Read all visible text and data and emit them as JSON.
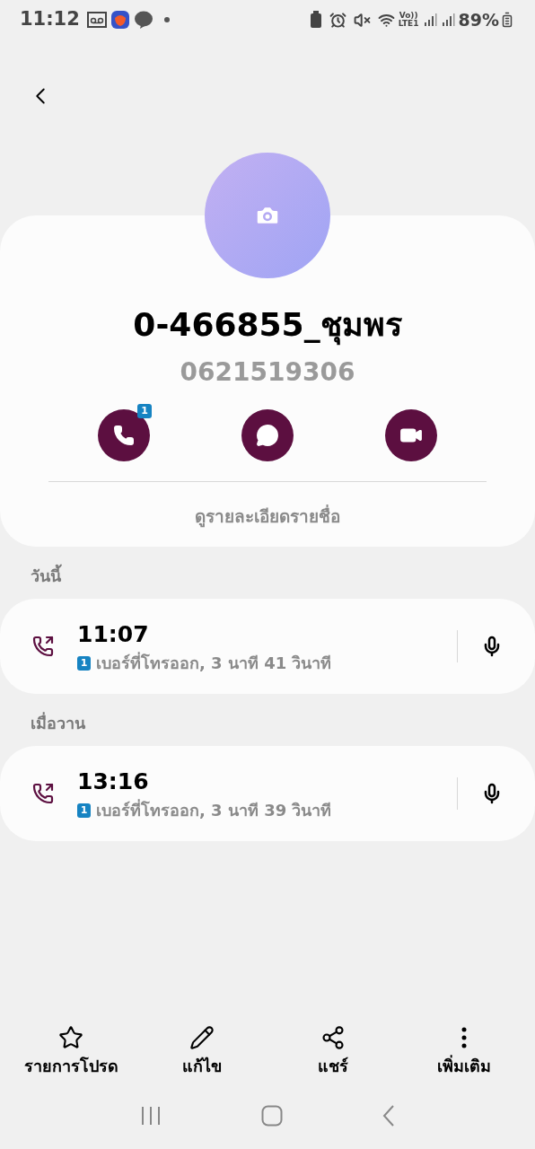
{
  "status_bar": {
    "time": "11:12",
    "network": "Vo))",
    "network_sub": "LTE1",
    "battery": "89%"
  },
  "contact": {
    "name": "0-466855_ชุมพร",
    "number": "0621519306",
    "call_badge": "1",
    "details_link": "ดูรายละเอียดรายชื่อ"
  },
  "history": [
    {
      "heading": "วันนี้",
      "calls": [
        {
          "kind": "outgoing",
          "time": "11:07",
          "sim": "1",
          "description": "เบอร์ที่โทรออก, 3 นาที 41 วินาที"
        }
      ]
    },
    {
      "heading": "เมื่อวาน",
      "calls": [
        {
          "kind": "outgoing",
          "time": "13:16",
          "sim": "1",
          "description": "เบอร์ที่โทรออก, 3 นาที 39 วินาที"
        }
      ]
    }
  ],
  "bottom_bar": [
    {
      "kind": "star",
      "label": "รายการโปรด"
    },
    {
      "kind": "edit",
      "label": "แก้ไข"
    },
    {
      "kind": "share",
      "label": "แชร์"
    },
    {
      "kind": "more",
      "label": "เพิ่มเติม"
    }
  ]
}
